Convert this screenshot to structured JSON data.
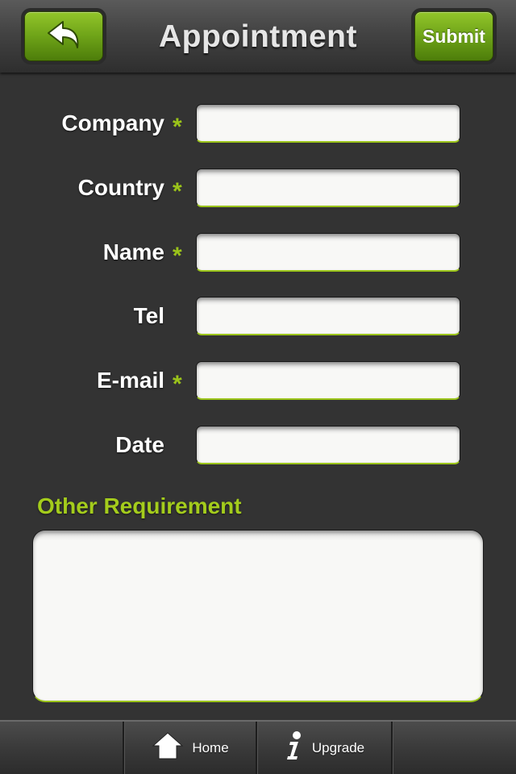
{
  "header": {
    "title": "Appointment",
    "back_icon": "back-arrow-icon",
    "submit_label": "Submit"
  },
  "form": {
    "required_mark": "*",
    "fields": [
      {
        "label": "Company",
        "required": true,
        "value": ""
      },
      {
        "label": "Country",
        "required": true,
        "value": ""
      },
      {
        "label": "Name",
        "required": true,
        "value": ""
      },
      {
        "label": "Tel",
        "required": false,
        "value": ""
      },
      {
        "label": "E-mail",
        "required": true,
        "value": ""
      },
      {
        "label": "Date",
        "required": false,
        "value": ""
      }
    ],
    "other_requirement_title": "Other Requirement",
    "other_requirement_value": ""
  },
  "tabbar": {
    "home_label": "Home",
    "home_icon": "home-icon",
    "upgrade_label": "Upgrade",
    "upgrade_icon": "info-icon"
  },
  "colors": {
    "accent_green": "#9bc41a",
    "background": "#333333",
    "button_green": "#6ea318"
  }
}
